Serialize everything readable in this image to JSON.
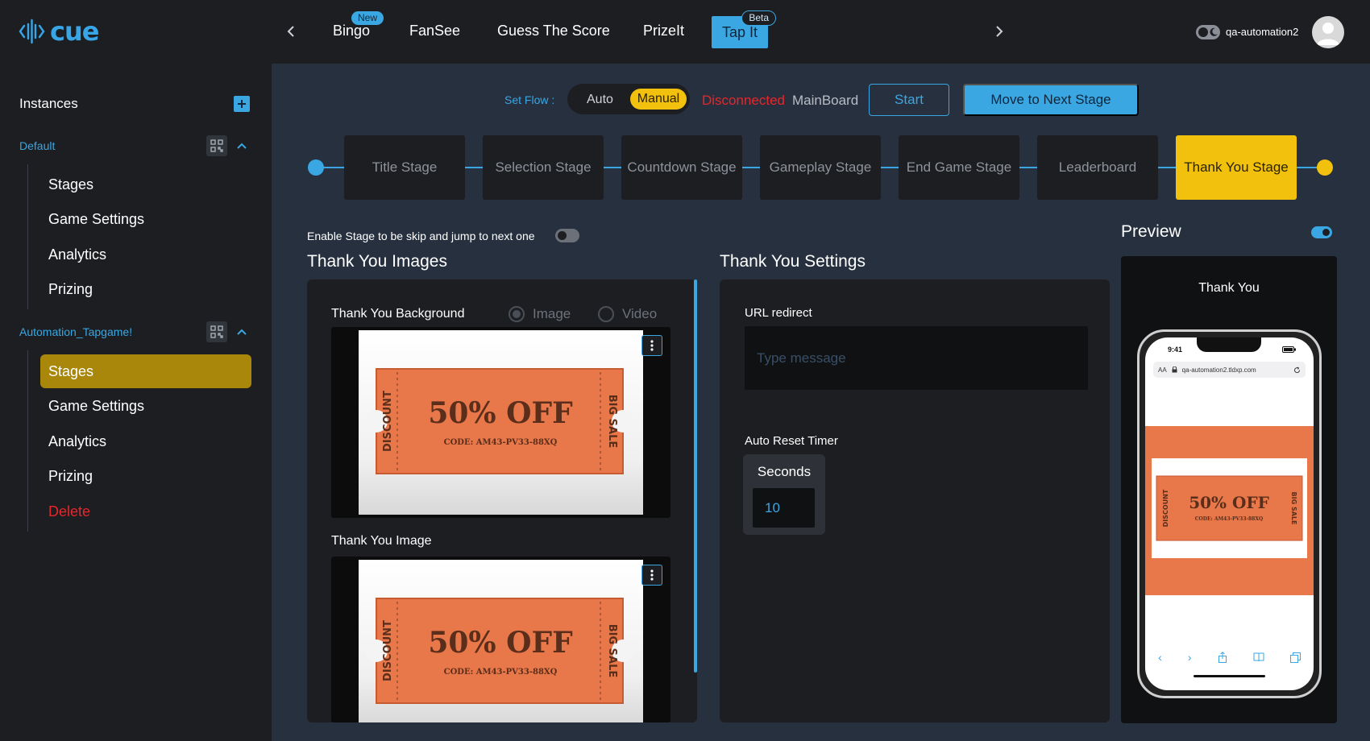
{
  "brand": {
    "name": "cue",
    "color": "#38a6e6"
  },
  "topnav": {
    "items": [
      {
        "label": "Bingo",
        "badge": "New"
      },
      {
        "label": "FanSee"
      },
      {
        "label": "Guess The Score"
      },
      {
        "label": "PrizeIt"
      },
      {
        "label": "Tap It",
        "badge": "Beta",
        "active": true
      }
    ]
  },
  "user": {
    "name": "qa-automation2"
  },
  "sidebar": {
    "title": "Instances",
    "instances": [
      {
        "name": "Default",
        "items": [
          "Stages",
          "Game Settings",
          "Analytics",
          "Prizing"
        ]
      },
      {
        "name": "Automation_Tapgame!",
        "items": [
          "Stages",
          "Game Settings",
          "Analytics",
          "Prizing",
          "Delete"
        ],
        "active_item": "Stages"
      }
    ]
  },
  "controls": {
    "set_flow_label": "Set Flow :",
    "flow_auto": "Auto",
    "flow_manual": "Manual",
    "flow_selected": "Manual",
    "connection_status": "Disconnected",
    "board_name": "MainBoard",
    "start_label": "Start",
    "next_stage_label": "Move to Next Stage"
  },
  "stages": [
    "Title Stage",
    "Selection Stage",
    "Countdown Stage",
    "Gameplay Stage",
    "End Game Stage",
    "Leaderboard",
    "Thank You Stage"
  ],
  "active_stage": "Thank You Stage",
  "content": {
    "skip_label": "Enable Stage to be skip and jump to next one",
    "skip_enabled": false,
    "images_heading": "Thank You Images",
    "background_label": "Thank You Background",
    "media_type_image": "Image",
    "media_type_video": "Video",
    "media_type_selected": "Image",
    "image_label": "Thank You Image",
    "coupon": {
      "left": "DISCOUNT",
      "main": "50% OFF",
      "code": "CODE: AM43-PV33-88XQ",
      "right": "BIG SALE"
    },
    "settings_heading": "Thank You Settings",
    "url_redirect_label": "URL redirect",
    "url_placeholder": "Type message",
    "url_value": "",
    "auto_reset_label": "Auto Reset Timer",
    "timer_unit": "Seconds",
    "timer_value": "10"
  },
  "preview": {
    "heading": "Preview",
    "enabled": true,
    "screen_title": "Thank You",
    "phone_time": "9:41",
    "phone_url": "qa-automation2.tldxp.com",
    "phone_aa": "AA"
  },
  "colors": {
    "accent": "#3aa7e3",
    "highlight": "#f2c10d",
    "danger": "#e8262a",
    "active_sidebar": "#a8870b",
    "coupon": "#e8774a"
  }
}
